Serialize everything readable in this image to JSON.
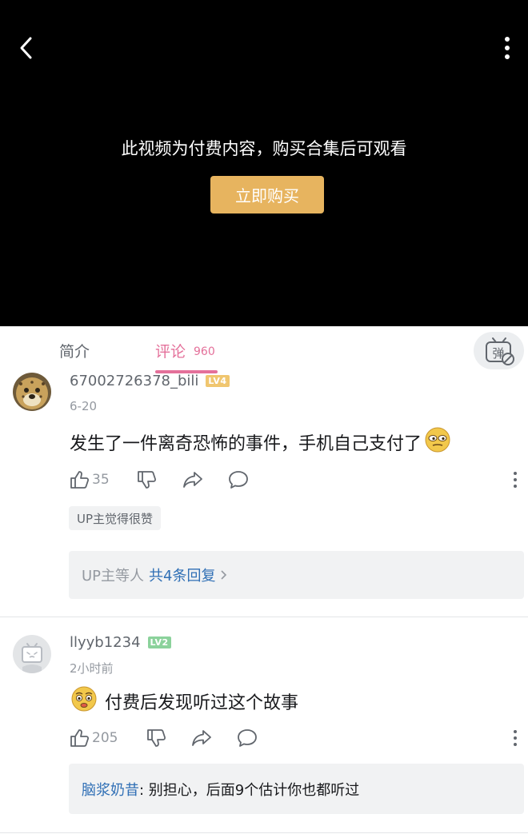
{
  "player": {
    "paywall_message": "此视频为付费内容，购买合集后可观看",
    "buy_button": "立即购买"
  },
  "tabs": {
    "intro": "简介",
    "comments": "评论",
    "comments_count": "960",
    "danmaku_toggle": "弹"
  },
  "comments": [
    {
      "username": "67002726378_bili",
      "level": "LV4",
      "date": "6-20",
      "text": "发生了一件离奇恐怖的事件，手机自己支付了",
      "emoji": "doge-squint-emoji",
      "likes": "35",
      "up_tag": "UP主觉得很赞",
      "replies_who": "UP主等人",
      "replies_link": "共4条回复"
    },
    {
      "username": "llyyb1234",
      "level": "LV2",
      "date": "2小时前",
      "emoji": "worried-face-emoji",
      "text": "付费后发现听过这个故事",
      "likes": "205",
      "reply_user": "脑浆奶昔",
      "reply_text": ": 别担心，后面9个估计你也都听过"
    }
  ],
  "colors": {
    "accent_pink": "#e4709a",
    "buy_gold": "#e7b45f",
    "link_blue": "#2f6fb5",
    "lv4": "#f0c66f",
    "lv2": "#8bd29b"
  }
}
